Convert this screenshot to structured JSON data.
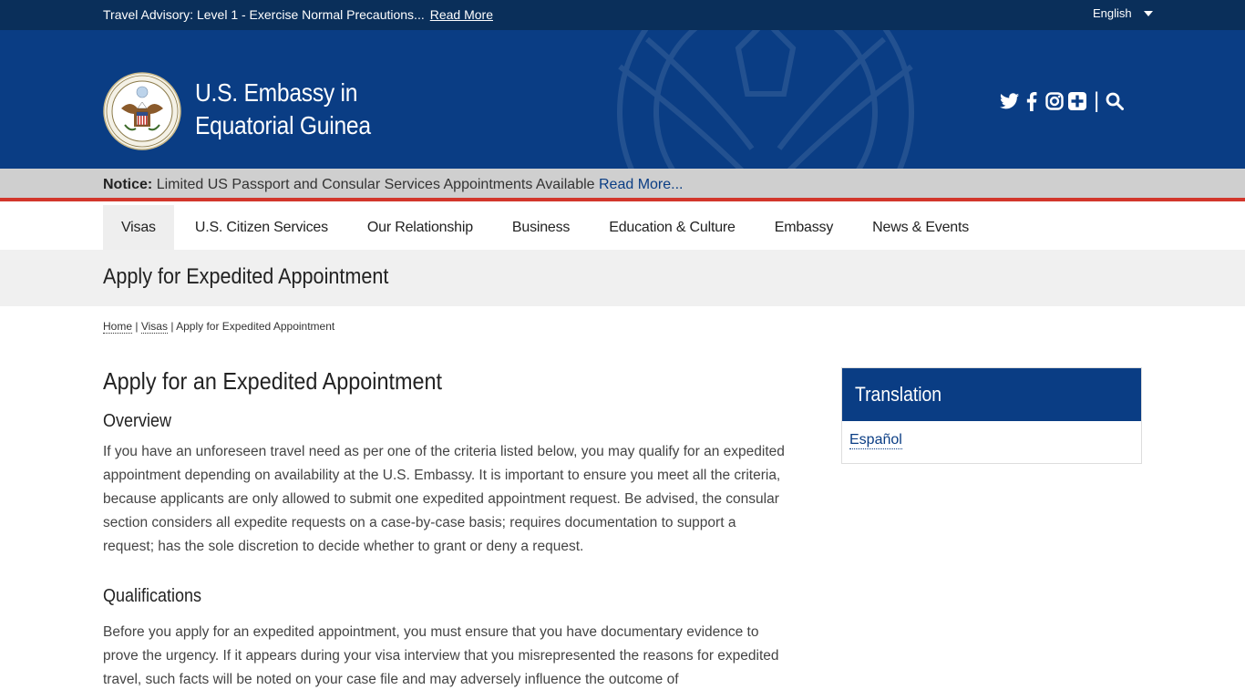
{
  "advisory": {
    "text": "Travel Advisory: Level 1 - Exercise Normal Precautions...",
    "link": "Read More"
  },
  "language": {
    "selected": "English"
  },
  "site": {
    "title_line1": "U.S. Embassy in",
    "title_line2": "Equatorial Guinea"
  },
  "social": {
    "icons": [
      "twitter-icon",
      "facebook-icon",
      "instagram-icon",
      "plus-icon",
      "search-icon"
    ],
    "separator": "|"
  },
  "notice": {
    "label": "Notice:",
    "text": "Limited US Passport and Consular Services Appointments Available",
    "link": "Read More..."
  },
  "nav": {
    "items": [
      {
        "label": "Visas"
      },
      {
        "label": "U.S. Citizen Services"
      },
      {
        "label": "Our Relationship"
      },
      {
        "label": "Business"
      },
      {
        "label": "Education & Culture"
      },
      {
        "label": "Embassy"
      },
      {
        "label": "News & Events"
      }
    ],
    "active": "Visas"
  },
  "page": {
    "title": "Apply for Expedited Appointment"
  },
  "breadcrumb": {
    "home": "Home",
    "sep": "|",
    "visas": "Visas",
    "current": "Apply for Expedited Appointment"
  },
  "content": {
    "heading": "Apply for an Expedited Appointment",
    "overview_heading": "Overview",
    "overview_text": "If you have an unforeseen travel need as per one of the criteria listed below, you may qualify for an expedited appointment depending on availability at the U.S. Embassy. It is important to ensure you meet all the criteria, because applicants are only allowed to submit one expedited appointment request.  Be advised, the consular section considers all expedite requests on a case-by-case basis; requires documentation to support a request; has the sole discretion to decide whether to grant or deny a request.",
    "qualifications_heading": "Qualifications",
    "qualifications_text": "Before you apply for an expedited appointment, you must ensure that you have documentary evidence to prove the urgency. If it appears during your visa interview that you misrepresented the reasons for expedited travel, such facts will be noted on your case file and may adversely influence the outcome of"
  },
  "sidebar": {
    "title": "Translation",
    "link": "Español"
  },
  "colors": {
    "header_blue": "#0a3d84",
    "advisory_navy": "#0a2f5a",
    "notice_red": "#d2362b",
    "notice_gray": "#cfcfcf"
  }
}
